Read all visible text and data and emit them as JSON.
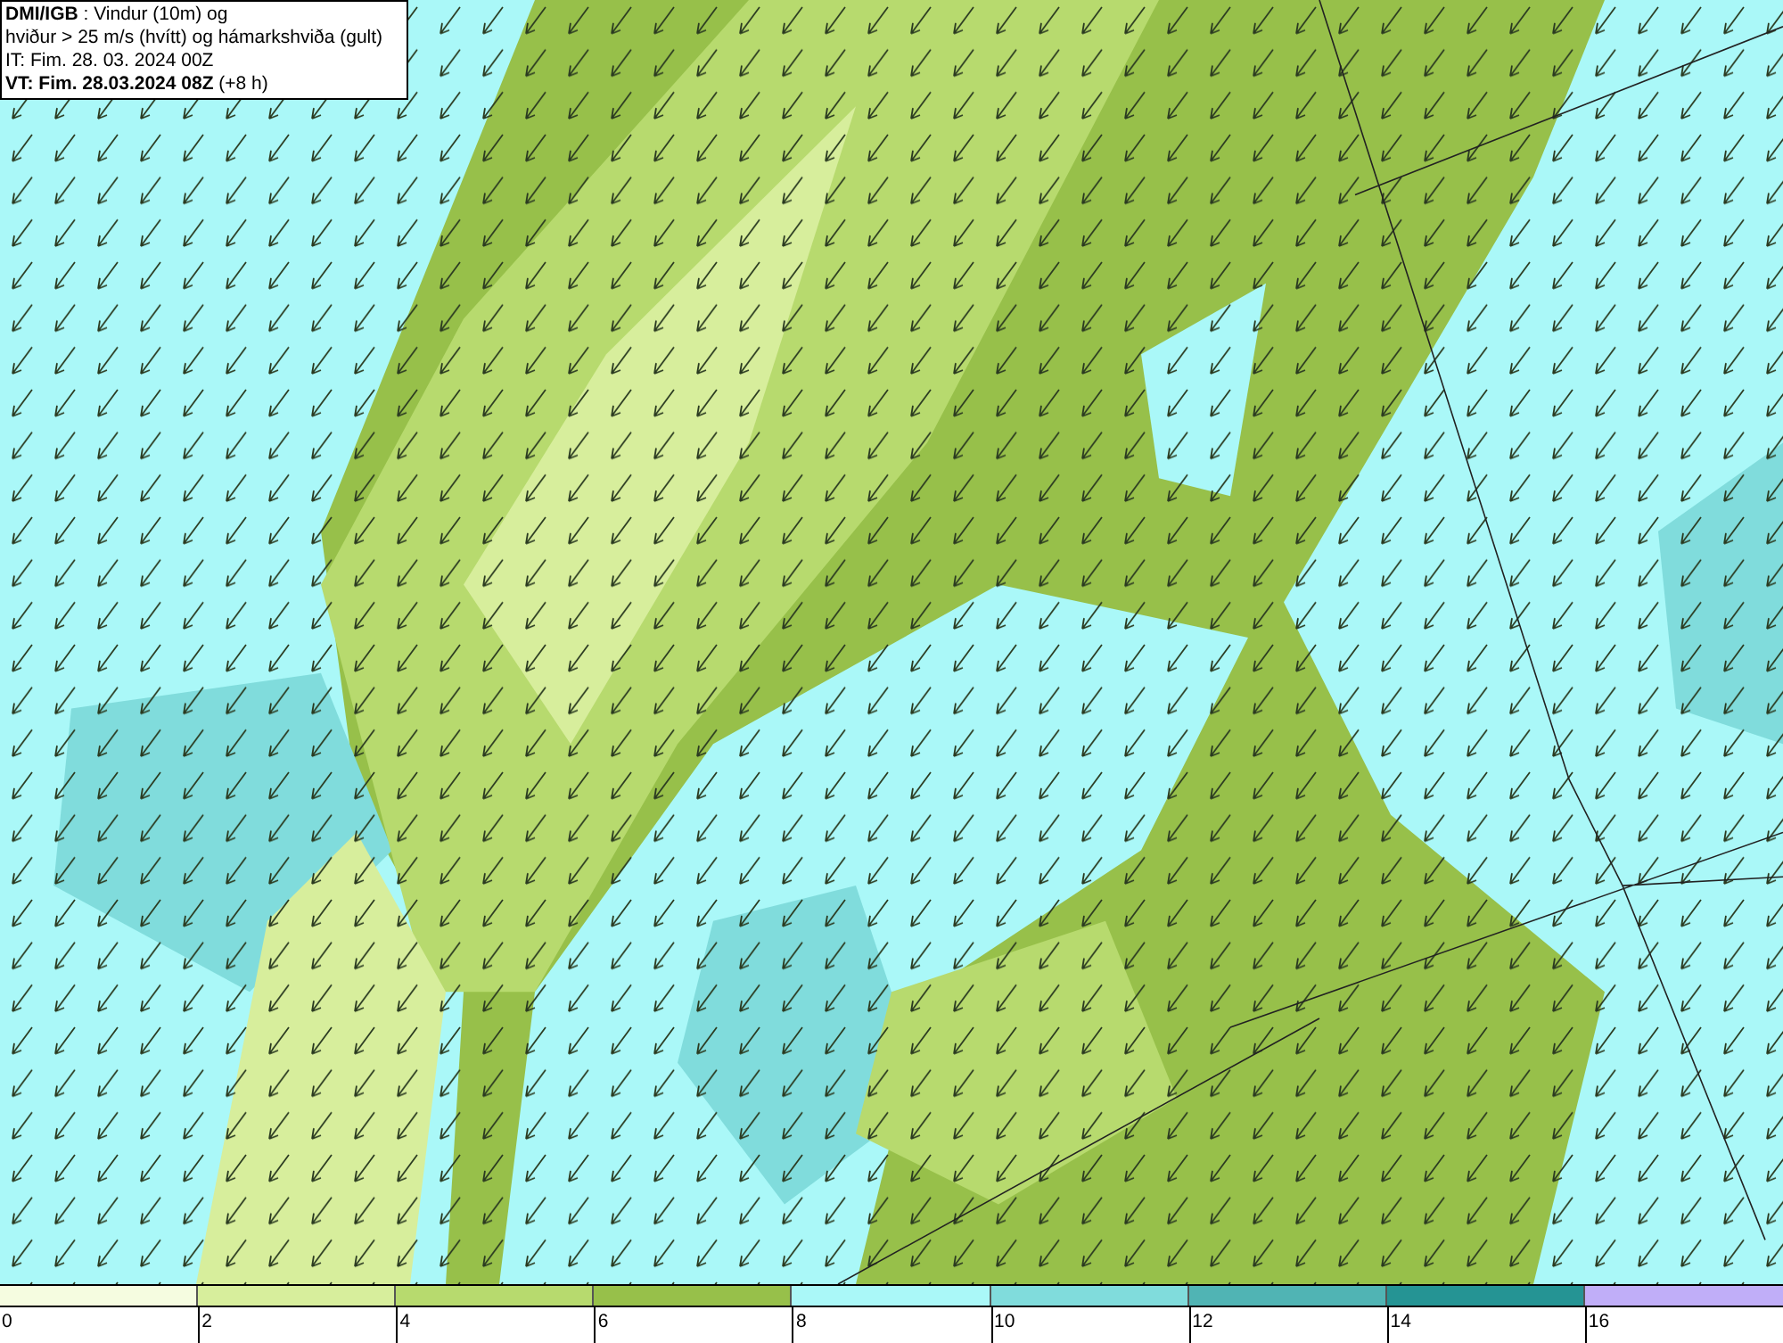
{
  "title_box": {
    "lines": [
      "**DMI/IGB** : Vindur (10m) og",
      "hviður > 25 m/s (hvítt) og hámarkshviða (gult)",
      "IT: Fim. 28. 03. 2024 00Z",
      "**VT: Fim. 28.03.2024 08Z** (+8 h)"
    ]
  },
  "legend": {
    "bins": [
      {
        "color": "#f5fce0"
      },
      {
        "color": "#d7ee9c"
      },
      {
        "color": "#b7da6e"
      },
      {
        "color": "#97c04a"
      },
      {
        "color": "#aaf8f8"
      },
      {
        "color": "#80dcdc"
      },
      {
        "color": "#50b4b4"
      },
      {
        "color": "#259494"
      },
      {
        "color": "#c0aef8"
      }
    ],
    "labels": [
      "0",
      "2",
      "4",
      "6",
      "8",
      "10",
      "12",
      "14",
      "16"
    ]
  }
}
